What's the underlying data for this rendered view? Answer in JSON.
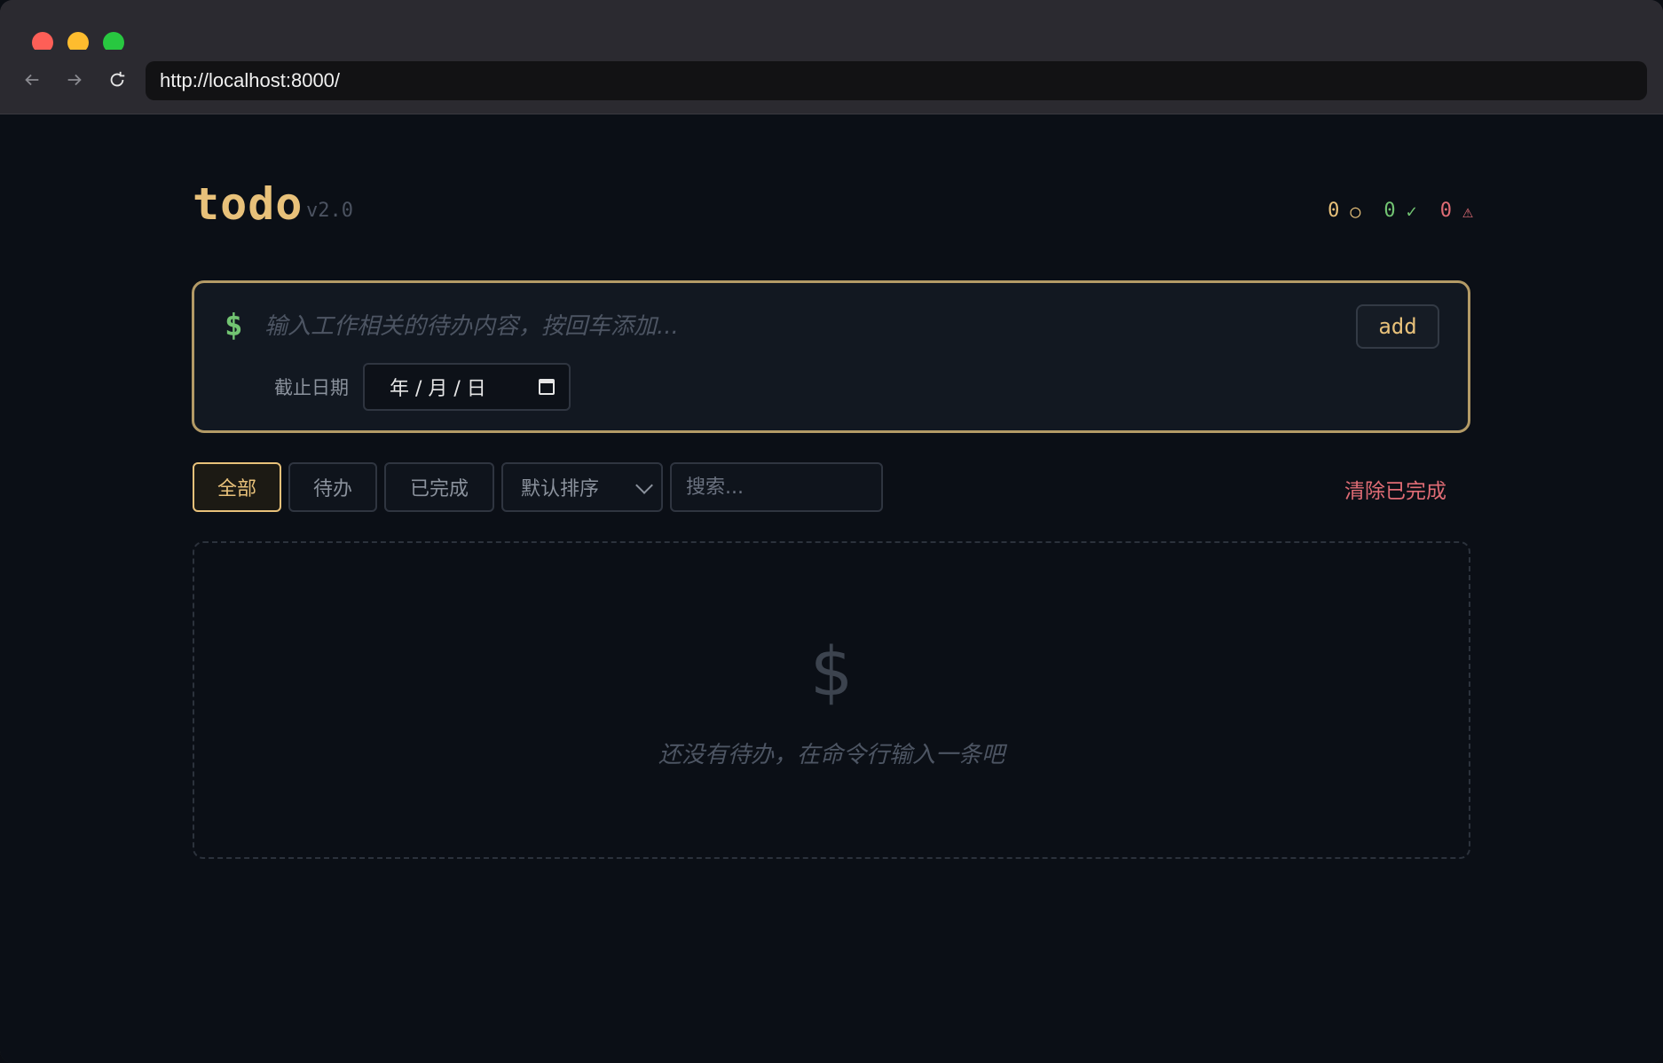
{
  "browser": {
    "url": "http://localhost:8000/"
  },
  "app": {
    "title": "todo",
    "version": "v2.0"
  },
  "stats": {
    "pending_count": "0",
    "pending_icon": "○",
    "done_count": "0",
    "done_icon": "✓",
    "overdue_count": "0",
    "overdue_icon": "⚠"
  },
  "composer": {
    "prompt": "$",
    "placeholder": "输入工作相关的待办内容，按回车添加...",
    "add_label": "add",
    "due_label": "截止日期",
    "date_value": "年 / 月 / 日"
  },
  "filters": {
    "all": "全部",
    "pending": "待办",
    "done": "已完成",
    "active": "all"
  },
  "sort": {
    "selected": "默认排序"
  },
  "search": {
    "placeholder": "搜索..."
  },
  "clear_completed": "清除已完成",
  "empty_state": {
    "icon": "$",
    "message": "还没有待办，在命令行输入一条吧"
  },
  "colors": {
    "accent": "#e8c17a",
    "success": "#72c472",
    "danger": "#e06c75",
    "background": "#0b0f16"
  }
}
